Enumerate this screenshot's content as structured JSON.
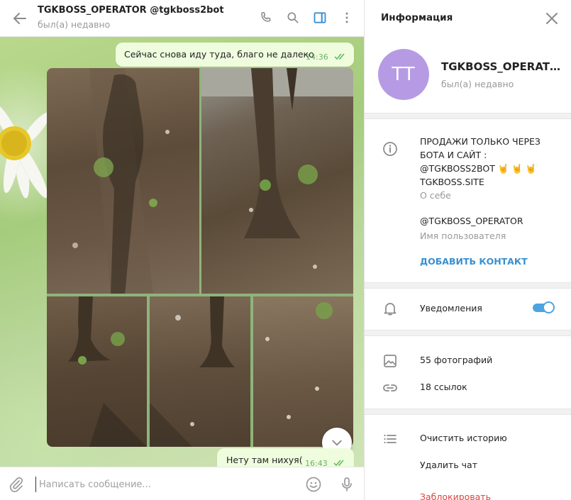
{
  "chat": {
    "title": "TGKBOSS_OPERATOR @tgkboss2bot",
    "status": "был(а) недавно",
    "messages": [
      {
        "text": "Сейчас снова иду туда, благо не далеко",
        "time": "14:36"
      },
      {
        "text": "Нету там нихуя(",
        "time": "16:43"
      }
    ],
    "album_count": 5,
    "composer_placeholder": "Написать сообщение..."
  },
  "info": {
    "title": "Информация",
    "avatar_initials": "TT",
    "name": "TGKBOSS_OPERATOR",
    "status": "был(а) недавно",
    "bio_lines": [
      "ПРОДАЖИ ТОЛЬКО ЧЕРЕЗ",
      "БОТА И САЙТ :",
      "@TGKBOSS2BOT 🤘 🤘 🤘",
      "TGKBOSS.SITE"
    ],
    "bio_label": "О себе",
    "username": "@TGKBOSS_OPERATOR",
    "username_label": "Имя пользователя",
    "add_contact": "ДОБАВИТЬ КОНТАКТ",
    "notifications_label": "Уведомления",
    "notifications_on": true,
    "photos": "55 фотографий",
    "links": "18 ссылок",
    "clear_history": "Очистить историю",
    "delete_chat": "Удалить чат",
    "block": "Заблокировать"
  },
  "colors": {
    "accent": "#4ea4e0",
    "bubble": "#effdde",
    "avatar": "#b69be4",
    "danger": "#d9453f"
  }
}
